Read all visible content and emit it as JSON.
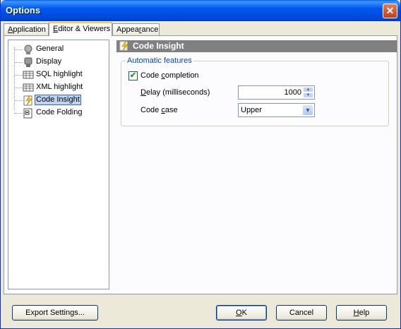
{
  "window": {
    "title": "Options",
    "close_glyph": "✕"
  },
  "tabs": [
    {
      "label_accel": "A",
      "label_rest": "pplication",
      "active": false
    },
    {
      "label_pre": "",
      "label_accel": "E",
      "label_rest": "ditor & Viewers",
      "active": true
    },
    {
      "label_pre": "Appea",
      "label_accel": "r",
      "label_rest": "ance",
      "active": false
    }
  ],
  "tree": {
    "items": [
      {
        "label": "General",
        "icon": "general-icon"
      },
      {
        "label": "Display",
        "icon": "display-icon"
      },
      {
        "label": "SQL highlight",
        "icon": "sql-highlight-icon"
      },
      {
        "label": "XML highlight",
        "icon": "xml-highlight-icon"
      },
      {
        "label": "Code Insight",
        "icon": "code-insight-icon",
        "selected": true
      },
      {
        "label": "Code Folding",
        "icon": "code-folding-icon"
      }
    ]
  },
  "section": {
    "title": "Code Insight",
    "group_title": "Automatic features",
    "code_completion": {
      "label_pre": "Code ",
      "label_accel": "c",
      "label_rest": "ompletion",
      "checked": true
    },
    "delay": {
      "label_accel": "D",
      "label_rest": "elay (milliseconds)",
      "value": "1000"
    },
    "code_case": {
      "label_pre": "Code ",
      "label_accel": "c",
      "label_rest": "ase",
      "value": "Upper"
    }
  },
  "buttons": {
    "export": "Export Settings...",
    "ok_accel": "O",
    "ok_rest": "K",
    "cancel": "Cancel",
    "help_accel": "H",
    "help_rest": "elp"
  },
  "colors": {
    "accent": "#0046d5",
    "selection": "#c1d2ee",
    "header": "#808080"
  }
}
